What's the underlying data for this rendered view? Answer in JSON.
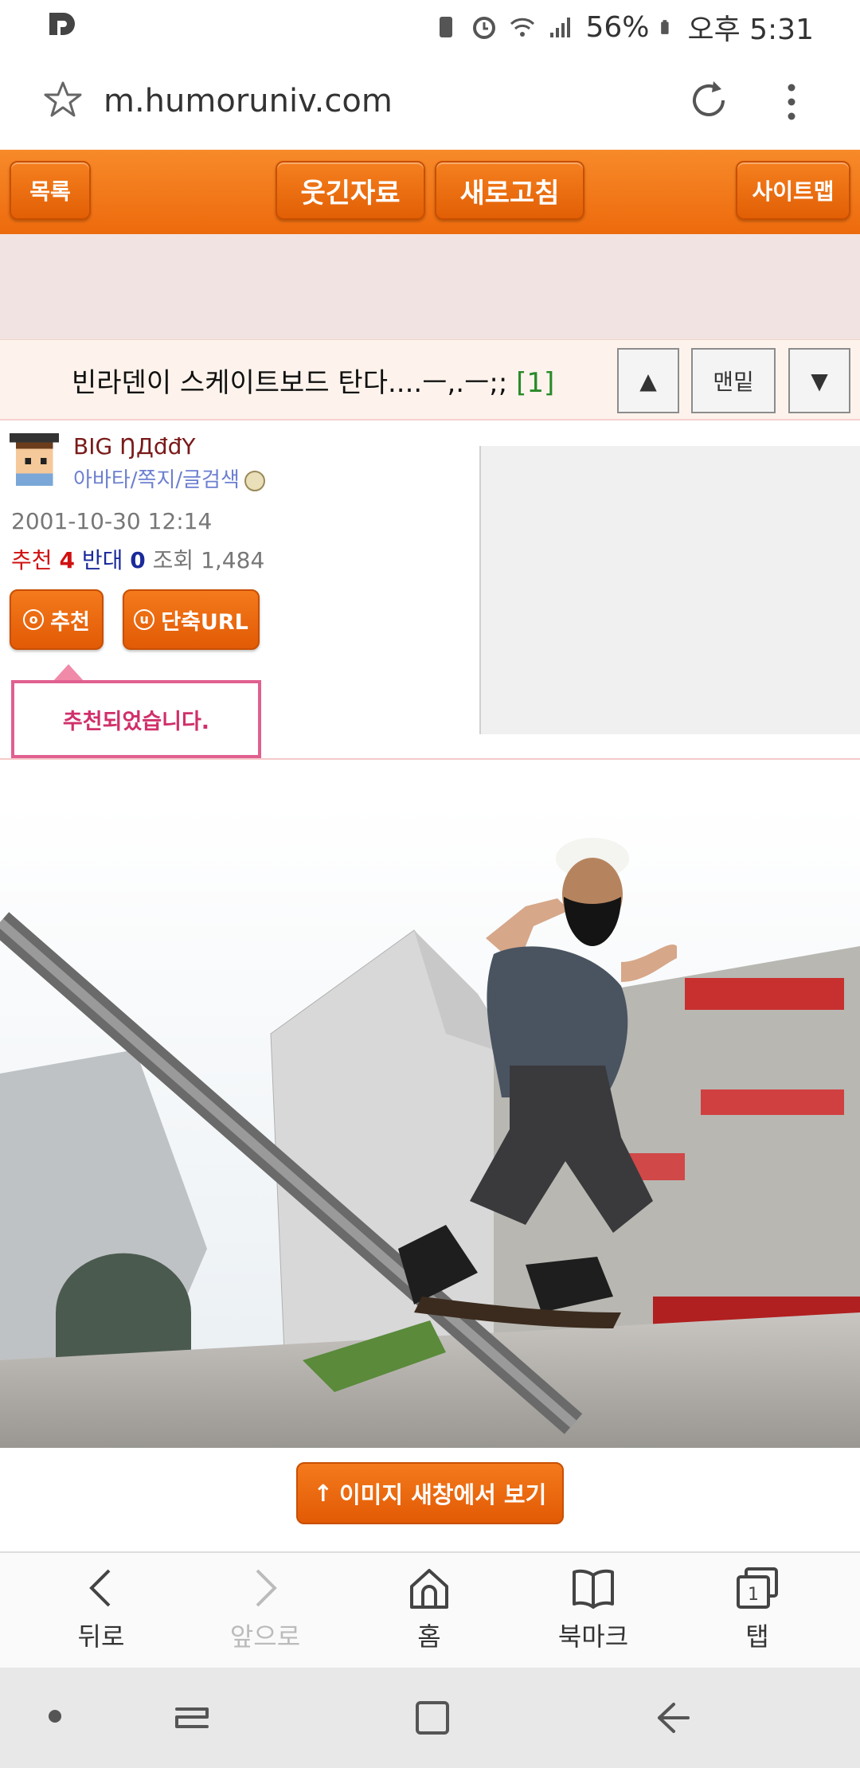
{
  "status_bar": {
    "battery": "56%",
    "time": "오후 5:31"
  },
  "browser": {
    "url": "m.humoruniv.com"
  },
  "nav": {
    "list": "목록",
    "funny": "웃긴자료",
    "refresh": "새로고침",
    "sitemap": "사이트맵"
  },
  "post": {
    "title": "빈라덴이 스케이트보드 탄다....ㅡ,.ㅡ;;",
    "comment_count": "[1]",
    "author": "BIG ŊДđđΥ",
    "author_links": "아바타/쪽지/글검색",
    "date": "2001-10-30 12:14",
    "rec_label": "추천",
    "rec_value": "4",
    "opp_label": "반대",
    "opp_value": "0",
    "views_label": "조회",
    "views_value": "1,484"
  },
  "title_buttons": {
    "up": "▲",
    "bottom": "맨밑",
    "down": "▼"
  },
  "actions": {
    "recommend": "추천",
    "short_url": "단축URL",
    "tooltip": "추천되었습니다."
  },
  "image_button": "이미지 새창에서 보기",
  "bottom_nav": [
    {
      "label": "뒤로",
      "icon": "back-icon"
    },
    {
      "label": "앞으로",
      "icon": "forward-icon"
    },
    {
      "label": "홈",
      "icon": "home-icon"
    },
    {
      "label": "북마크",
      "icon": "bookmark-icon"
    },
    {
      "label": "탭",
      "icon": "tabs-icon",
      "count": "1"
    }
  ],
  "colors": {
    "accent": "#ef700f",
    "tooltip": "#e06090"
  }
}
